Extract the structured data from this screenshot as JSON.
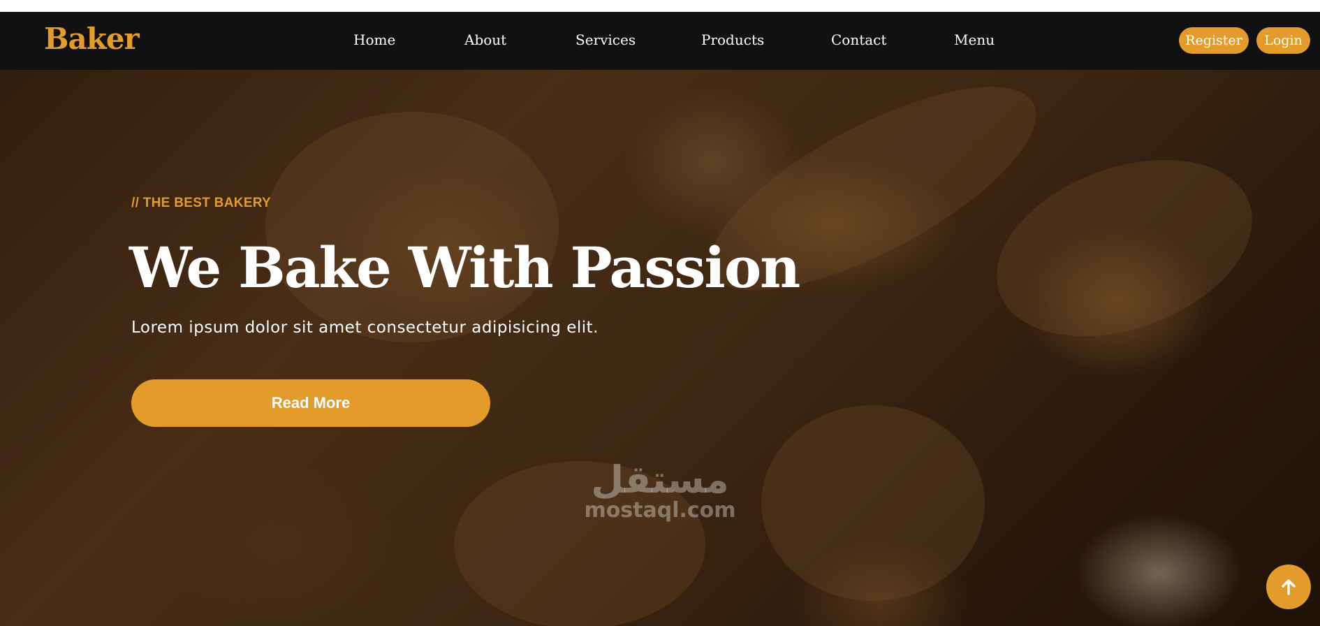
{
  "brand": {
    "name": "Baker",
    "color": "#e39c2b"
  },
  "nav": {
    "links": [
      "Home",
      "About",
      "Services",
      "Products",
      "Contact",
      "Menu"
    ],
    "register_label": "Register",
    "login_label": "Login"
  },
  "hero": {
    "eyebrow": "// THE BEST BAKERY",
    "title": "We Bake With Passion",
    "subtitle": "Lorem ipsum dolor sit amet consectetur adipisicing elit.",
    "cta_label": "Read More"
  },
  "watermark": {
    "arabic": "مستقل",
    "text": "mostaql.com"
  },
  "scroll_top": {
    "icon": "arrow-up-icon"
  },
  "colors": {
    "accent": "#e39c2b",
    "navbar": "#111111"
  }
}
